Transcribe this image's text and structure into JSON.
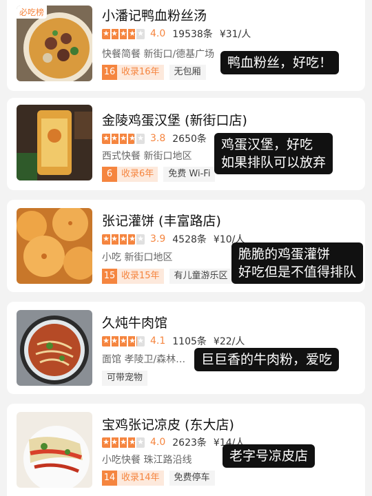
{
  "restaurants": [
    {
      "name": "小潘记鸭血粉丝汤",
      "score": "4.0",
      "score_fraction": 0.8,
      "reviews": "19538条",
      "price": "¥31/人",
      "meta": "快餐简餐 新街口/德基广场",
      "years_num": "16",
      "years_text": "收录16年",
      "tags": [
        "无包厢"
      ],
      "rank_badge": "必吃榜",
      "bubble": "鸭血粉丝，好吃！"
    },
    {
      "name": "金陵鸡蛋汉堡 (新街口店)",
      "score": "3.8",
      "score_fraction": 0.76,
      "reviews": "2650条",
      "price": "",
      "meta": "西式快餐 新街口地区",
      "years_num": "6",
      "years_text": "收录6年",
      "tags": [
        "免费 Wi-Fi"
      ],
      "bubble_lines": [
        "鸡蛋汉堡，好吃",
        "如果排队可以放弃"
      ]
    },
    {
      "name": "张记灌饼 (丰富路店)",
      "score": "3.9",
      "score_fraction": 0.78,
      "reviews": "4528条",
      "price": "¥10/人",
      "meta": "小吃 新街口地区",
      "years_num": "15",
      "years_text": "收录15年",
      "tags": [
        "有儿童游乐区"
      ],
      "bubble_lines": [
        "脆脆的鸡蛋灌饼",
        "好吃但是不值得排队"
      ]
    },
    {
      "name": "久炖牛肉馆",
      "score": "4.1",
      "score_fraction": 0.82,
      "reviews": "1105条",
      "price": "¥22/人",
      "meta": "面馆 孝陵卫/森林…",
      "tags": [
        "可带宠物"
      ],
      "bubble": "巨巨香的牛肉粉，爱吃"
    },
    {
      "name": "宝鸡张记凉皮 (东大店)",
      "score": "4.0",
      "score_fraction": 0.8,
      "reviews": "2623条",
      "price": "¥14/人",
      "meta": "小吃快餐 珠江路沿线",
      "years_num": "14",
      "years_text": "收录14年",
      "tags": [
        "免费停车"
      ],
      "bubble": "老字号凉皮店"
    }
  ],
  "colors": {
    "accent": "#f5853f",
    "bubble_bg": "#111111"
  }
}
